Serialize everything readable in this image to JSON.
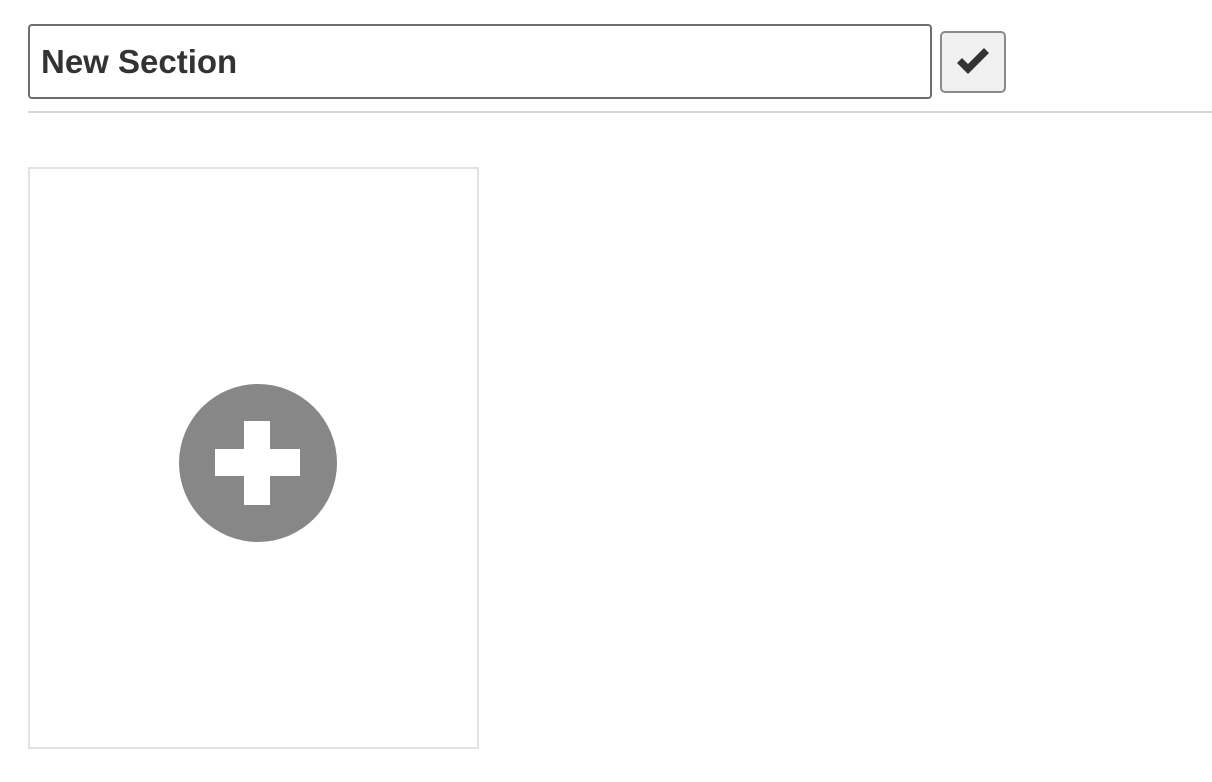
{
  "section_editor": {
    "title_input": {
      "value": "New Section"
    },
    "confirm_button": {
      "icon": "checkmark-icon"
    }
  },
  "content": {
    "add_card": {
      "icon": "plus-circle-icon"
    }
  },
  "colors": {
    "text": "#333333",
    "input_border": "#6e6e6e",
    "button_bg": "#f0f0f0",
    "divider": "#d6d6d6",
    "card_border": "#e2e2e2",
    "add_icon_fill": "#878787"
  }
}
